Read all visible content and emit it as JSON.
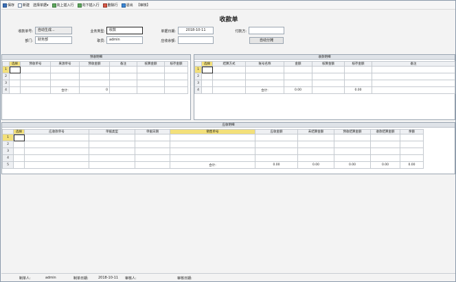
{
  "toolbar": {
    "save": "保存",
    "new": "新建",
    "select_doc": "选择单据▾",
    "insert_above": "向上插入行",
    "insert_below": "向下插入行",
    "delete_row": "删除行",
    "exit": "退出",
    "audit": "【审核】"
  },
  "header": {
    "title": "收款单",
    "receipt_no_label": "收款单号:",
    "receipt_no_value": "自动生成...",
    "biz_type_label": "业务类型:",
    "biz_type_value": "收款",
    "doc_date_label": "单据日期:",
    "doc_date_value": "2018-10-11",
    "payer_label": "付款方:",
    "payer_value": "",
    "dept_label": "部门:",
    "dept_value": "财务部",
    "staff_label": "职员:",
    "staff_value": "admin",
    "receivable_label": "应收余额:",
    "receivable_value": "",
    "auto_alloc": "自动分摊"
  },
  "prepay": {
    "caption": "预收明细",
    "headers": [
      "选择",
      "预收单号",
      "来源单号",
      "预收金额",
      "备注",
      "核算金额",
      "核存金额"
    ],
    "rows": [
      "1",
      "2",
      "3"
    ],
    "total_row": "4",
    "total_label": "合计:",
    "total_amount": "0"
  },
  "receipt": {
    "caption": "收款明细",
    "headers": [
      "选择",
      "结算方式",
      "账号名称",
      "金额",
      "核算金额",
      "核存金额",
      "备注"
    ],
    "rows": [
      "1",
      "2",
      "3"
    ],
    "total_row": "4",
    "total_label": "合计:",
    "total_amount": "0.00",
    "total_stock": "0.00"
  },
  "receivable": {
    "caption": "应收明细",
    "headers": [
      "选择",
      "应收款单号",
      "单据类型",
      "单据日期",
      "销售单号",
      "应收金额",
      "未结算金额",
      "预收结算金额",
      "收款结算金额",
      "余额"
    ],
    "rows": [
      "1",
      "2",
      "3",
      "4"
    ],
    "total_row": "5",
    "total_label": "合计:",
    "totals": [
      "0.00",
      "0.00",
      "0.00",
      "0.00",
      "0.00"
    ]
  },
  "footer": {
    "maker_label": "制单人:",
    "maker_value": "admin",
    "make_date_label": "制单日期:",
    "make_date_value": "2018-10-11",
    "auditor_label": "审核人:",
    "auditor_value": "",
    "audit_date_label": "审核日期:",
    "audit_date_value": ""
  }
}
